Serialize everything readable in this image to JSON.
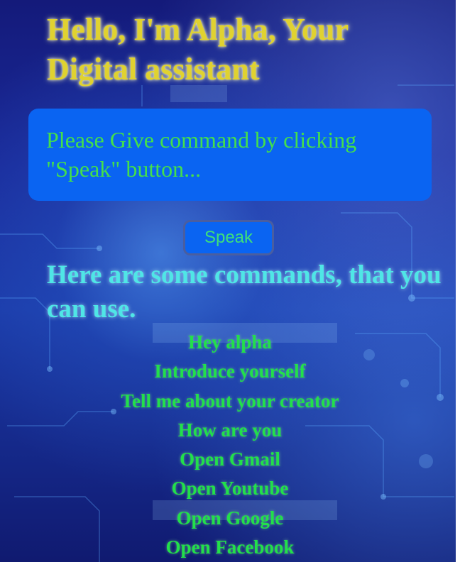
{
  "header": {
    "title": "Hello, I'm Alpha, Your Digital assistant"
  },
  "prompt": {
    "text": "Please Give command by clicking \"Speak\" button..."
  },
  "speak_button": {
    "label": "Speak"
  },
  "commands": {
    "heading": "Here are some commands, that you can use.",
    "items": [
      "Hey alpha",
      "Introduce yourself",
      "Tell me about your creator",
      "How are you",
      "Open Gmail",
      "Open Youtube",
      "Open Google",
      "Open Facebook"
    ]
  },
  "colors": {
    "title": "#e0d230",
    "prompt_box": "#0a64f2",
    "prompt_text": "#44e04a",
    "heading": "#4fe6e6",
    "command_text": "#22e04a"
  }
}
